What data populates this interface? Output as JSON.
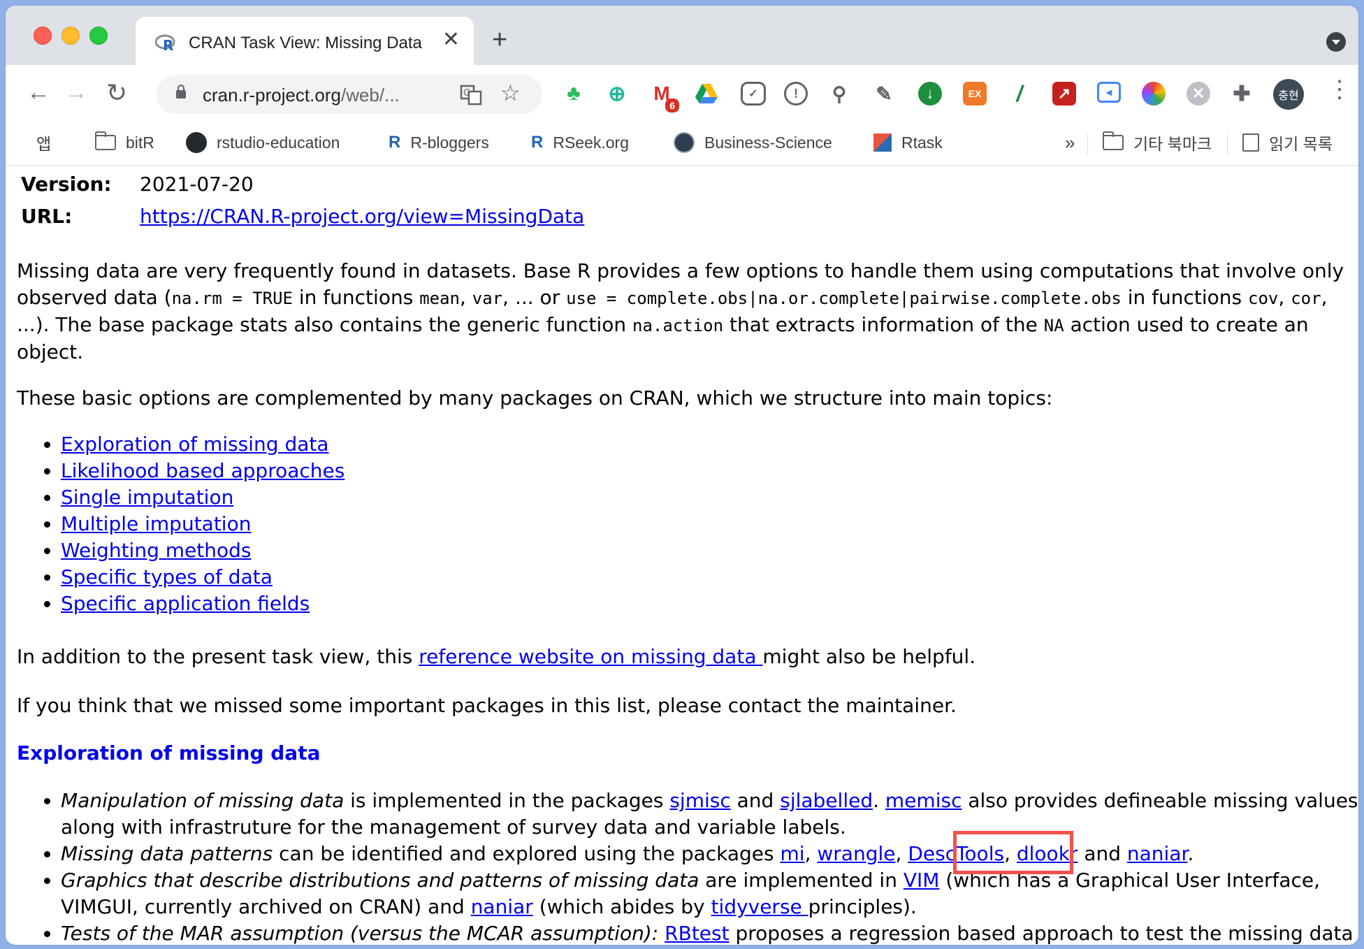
{
  "browser": {
    "tab_title": "CRAN Task View: Missing Data",
    "tab_close": "✕",
    "new_tab": "+",
    "url_host": "cran.r-project.org",
    "url_rest": "/web/...",
    "back": "←",
    "forward": "→",
    "reload": "↻",
    "menu": "⋮",
    "profile_label": "충현",
    "extension_badge": "6"
  },
  "bookmarks": [
    {
      "label": "앱"
    },
    {
      "label": "bitR"
    },
    {
      "label": "rstudio-education"
    },
    {
      "label": "R-bloggers"
    },
    {
      "label": "RSeek.org"
    },
    {
      "label": "Business-Science"
    },
    {
      "label": "Rtask"
    }
  ],
  "bookmarks_overflow": "»",
  "bookmarks_other": "기타 북마크",
  "bookmarks_reading": "읽기 목록",
  "page": {
    "version_label": "Version:",
    "version_value": "2021-07-20",
    "url_label": "URL:",
    "url_value": "https://CRAN.R-project.org/view=MissingData",
    "intro": {
      "t1": "Missing data are very frequently found in datasets. Base R provides a few options to handle them using computations that involve only observed data (",
      "c1": "na.rm = TRUE",
      "t2": " in functions ",
      "c2": "mean",
      "t3": ", ",
      "c3": "var",
      "t4": ", ... or ",
      "c4": "use = complete.obs|na.or.complete|pairwise.complete.obs",
      "t5": " in functions ",
      "c5": "cov",
      "t6": ", ",
      "c6": "cor",
      "t7": ", ...). The base package stats also contains the generic function ",
      "c7": "na.action",
      "t8": " that extracts information of the ",
      "c8": "NA",
      "t9": " action used to create an object."
    },
    "topics_intro": "These basic options are complemented by many packages on CRAN, which we structure into main topics:",
    "topics": [
      "Exploration of missing data",
      "Likelihood based approaches",
      "Single imputation",
      "Multiple imputation",
      "Weighting methods",
      "Specific types of data",
      "Specific application fields"
    ],
    "addition": {
      "before": "In addition to the present task view, this ",
      "link": "reference website on missing data ",
      "after": "might also be helpful."
    },
    "missed": "If you think that we missed some important packages in this list, please contact the maintainer.",
    "section_title": "Exploration of missing data",
    "bullets": {
      "b1": {
        "em": "Manipulation of missing data",
        "t1": " is implemented in the packages ",
        "l1": "sjmisc",
        "t2": " and ",
        "l2": "sjlabelled",
        "t3": ". ",
        "l3": "memisc",
        "t4": " also provides defineable missing values, along with infrastruture for the management of survey data and variable labels."
      },
      "b2": {
        "em": "Missing data patterns",
        "t1": " can be identified and explored using the packages ",
        "l1": "mi",
        "t2": ", ",
        "l2": "wrangle",
        "t3": ", ",
        "l3": "DescTools",
        "t4": ", ",
        "l4": "dlookr",
        "t5": " and ",
        "l5": "naniar",
        "t6": "."
      },
      "b3": {
        "em": "Graphics that describe distributions and patterns of missing data",
        "t1": " are implemented in ",
        "l1": "VIM",
        "t2": " (which has a Graphical User Interface, VIMGUI, currently archived on CRAN) and ",
        "l2": "naniar",
        "t3": " (which abides by ",
        "l3": "tidyverse ",
        "t4": "principles)."
      },
      "b4": {
        "em": "Tests of the MAR assumption (versus the MCAR assumption):",
        "t1": " ",
        "l1": "RBtest",
        "t2": " proposes a regression based approach to test the missing data"
      }
    }
  },
  "colors": {
    "link": "#0000ee",
    "highlight_box": "#f0524b",
    "desktop": "#8fb1e8",
    "tabstrip": "#dee1e6"
  }
}
